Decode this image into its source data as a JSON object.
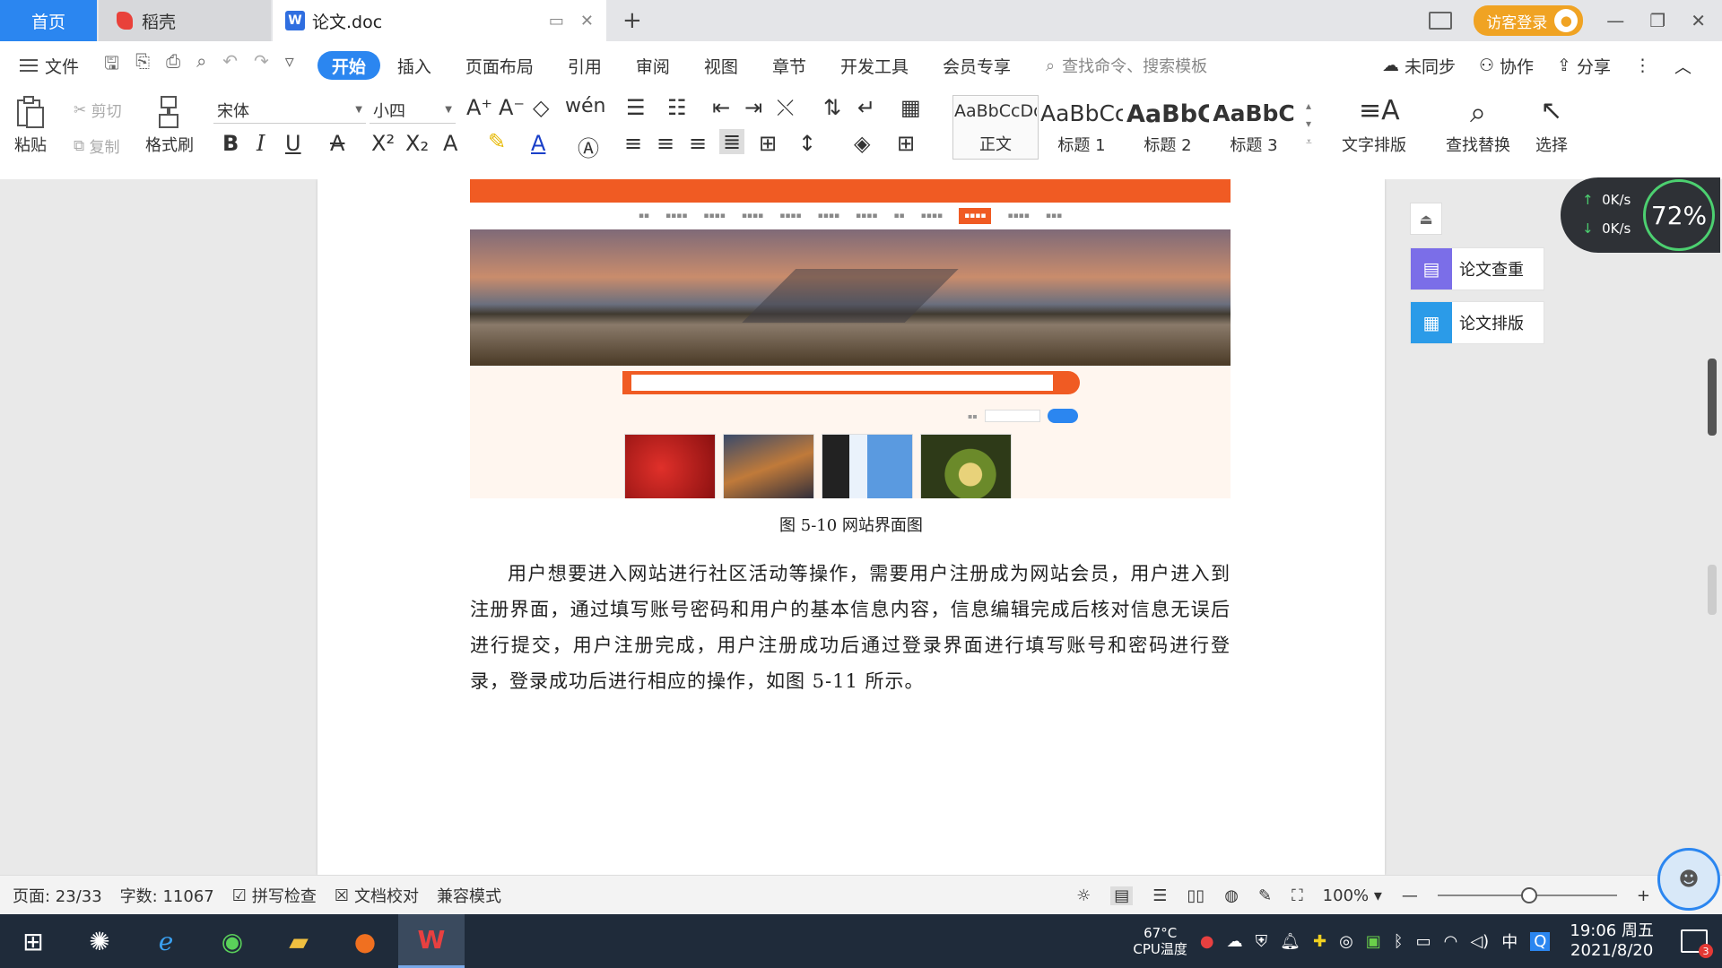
{
  "tabs": {
    "home": "首页",
    "daoke": "稻壳",
    "doc": "论文.doc",
    "new_tab": "+"
  },
  "titlebar": {
    "login": "访客登录"
  },
  "menu": {
    "file": "文件",
    "tabs": [
      "开始",
      "插入",
      "页面布局",
      "引用",
      "审阅",
      "视图",
      "章节",
      "开发工具",
      "会员专享"
    ],
    "active_tab": "开始",
    "search_placeholder": "查找命令、搜索模板",
    "unsync": "未同步",
    "collab": "协作",
    "share": "分享"
  },
  "ribbon": {
    "paste": "粘贴",
    "cut": "剪切",
    "copy": "复制",
    "format_painter": "格式刷",
    "font_name": "宋体",
    "font_size": "小四",
    "bold": "B",
    "italic": "I",
    "underline": "U",
    "styles": [
      {
        "preview": "AaBbCcDd",
        "name": "正文"
      },
      {
        "preview": "AaBbCc",
        "name": "标题 1"
      },
      {
        "preview": "AaBbC",
        "name": "标题 2"
      },
      {
        "preview": "AaBbC",
        "name": "标题 3"
      }
    ],
    "text_layout": "文字排版",
    "find_replace": "查找替换",
    "select": "选择"
  },
  "document": {
    "caption": "图 5-10  网站界面图",
    "paragraph": "用户想要进入网站进行社区活动等操作，需要用户注册成为网站会员，用户进入到注册界面，通过填写账号密码和用户的基本信息内容，信息编辑完成后核对信息无误后进行提交，用户注册完成，用户注册成功后通过登录界面进行填写账号和密码进行登录，登录成功后进行相应的操作，如图 5-11 所示。"
  },
  "side_panel": {
    "check": "论文查重",
    "format": "论文排版"
  },
  "network_widget": {
    "up": "0K/s",
    "down": "0K/s",
    "percent": "72%"
  },
  "status": {
    "page": "页面: 23/33",
    "words": "字数: 11067",
    "spell": "拼写检查",
    "proof": "文档校对",
    "compat": "兼容模式",
    "zoom": "100%",
    "zoom_level": 0.5
  },
  "taskbar": {
    "cpu_temp": "67°C",
    "cpu_label": "CPU温度",
    "ime": "中",
    "time": "19:06 周五",
    "date": "2021/8/20",
    "notif_count": "3"
  },
  "colors": {
    "accent": "#2b86f0",
    "login": "#f0a323",
    "taskbar": "#1f2b3a"
  }
}
